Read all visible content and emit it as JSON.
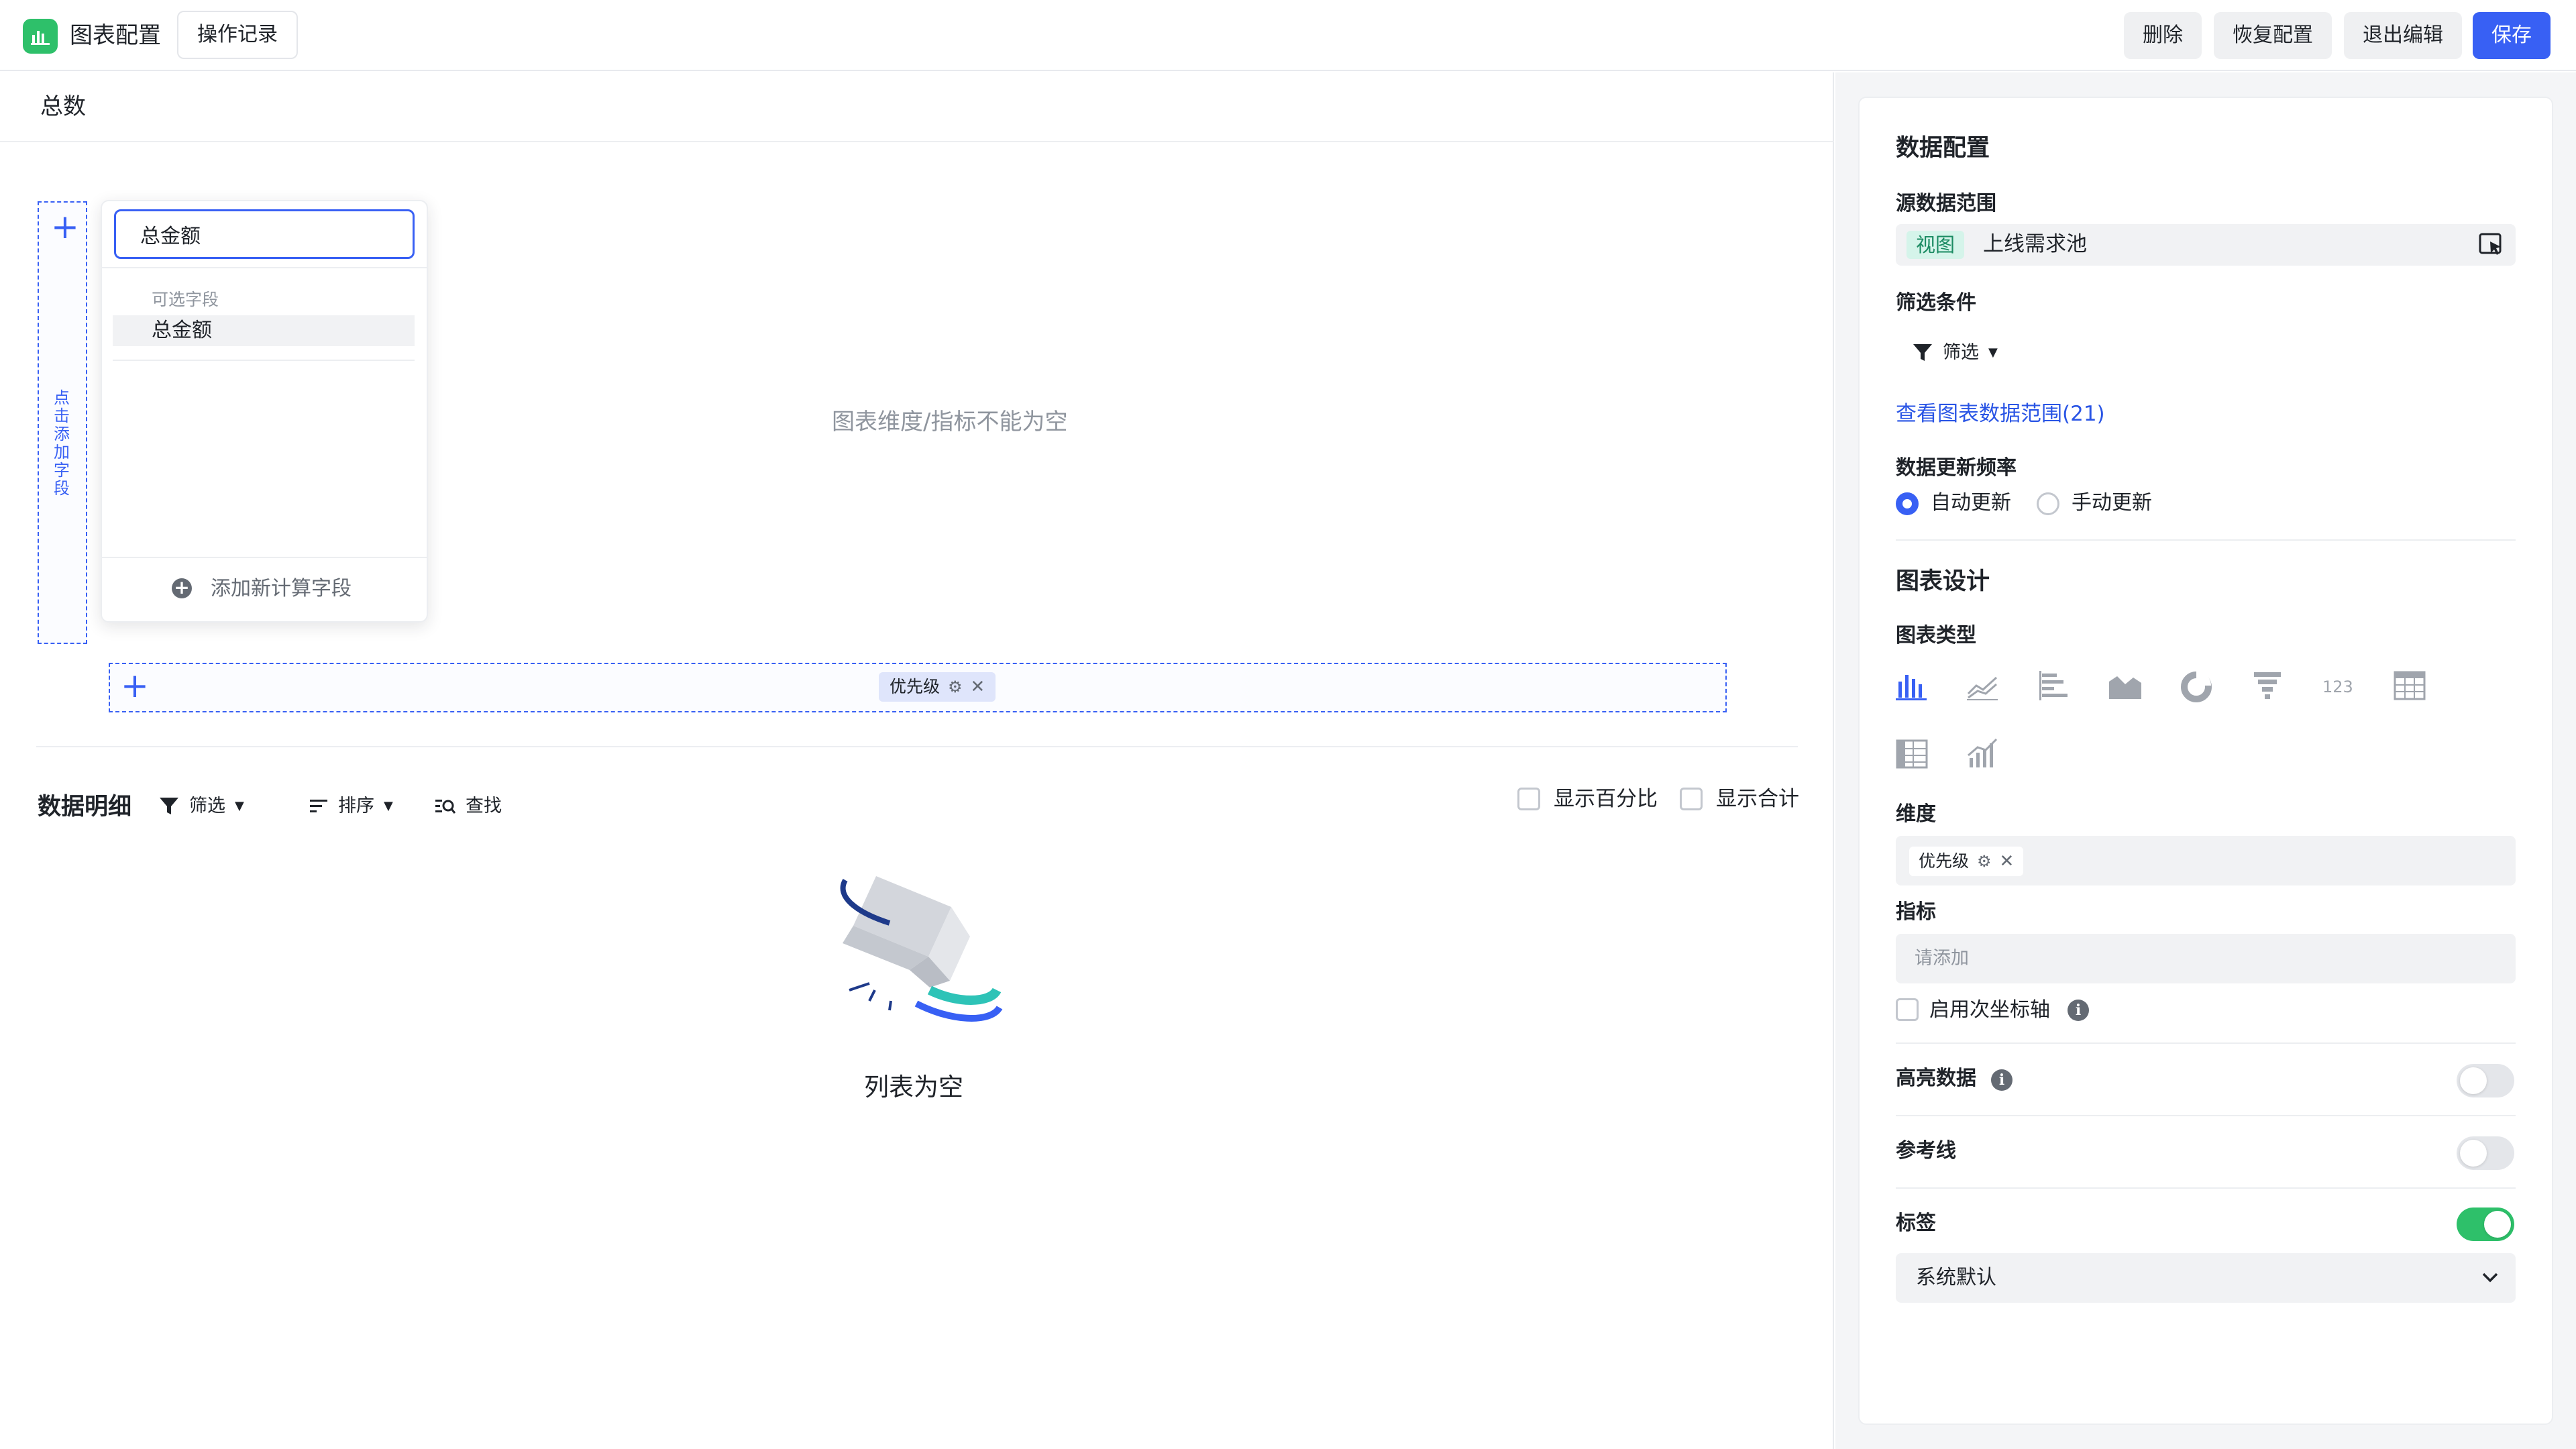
{
  "topbar": {
    "title": "图表配置",
    "history_label": "操作记录",
    "delete_label": "删除",
    "restore_label": "恢复配置",
    "exit_label": "退出编辑",
    "save_label": "保存",
    "accent_color": "#3860f4",
    "app_icon": "bar-chart-icon"
  },
  "chart": {
    "title": "总数",
    "y_drop_hint": "点击添加字段",
    "empty_message": "图表维度/指标不能为空",
    "x_chip_label": "优先级"
  },
  "field_dropdown": {
    "search_value": "总金额",
    "group_label": "可选字段",
    "options": [
      "总金额"
    ],
    "add_calc_label": "添加新计算字段"
  },
  "detail": {
    "title": "数据明细",
    "filter_label": "筛选",
    "sort_label": "排序",
    "find_label": "查找",
    "show_percent_label": "显示百分比",
    "show_percent_checked": false,
    "show_total_label": "显示合计",
    "show_total_checked": false,
    "empty_message": "列表为空"
  },
  "config": {
    "data_config_title": "数据配置",
    "source_label": "源数据范围",
    "source_tag": "视图",
    "source_name": "上线需求池",
    "filter_section_label": "筛选条件",
    "filter_label": "筛选",
    "view_range_link": "查看图表数据范围(21)",
    "freq_label": "数据更新频率",
    "freq_auto": "自动更新",
    "freq_manual": "手动更新",
    "freq_selected": "自动更新",
    "chart_design_title": "图表设计",
    "chart_type_label": "图表类型",
    "chart_types": [
      "bar-chart-icon",
      "line-chart-icon",
      "horizontal-bar-icon",
      "area-chart-icon",
      "pie-chart-icon",
      "funnel-chart-icon",
      "number-card-icon",
      "table-icon",
      "pivot-table-icon",
      "combo-chart-icon"
    ],
    "chart_type_selected": "bar-chart-icon",
    "dimension_label": "维度",
    "dimension_chip": "优先级",
    "metric_label": "指标",
    "metric_placeholder": "请添加",
    "second_axis_label": "启用次坐标轴",
    "second_axis_checked": false,
    "highlight_label": "高亮数据",
    "highlight_on": false,
    "refline_label": "参考线",
    "refline_on": false,
    "label_label": "标签",
    "label_on": true,
    "label_select_value": "系统默认"
  }
}
